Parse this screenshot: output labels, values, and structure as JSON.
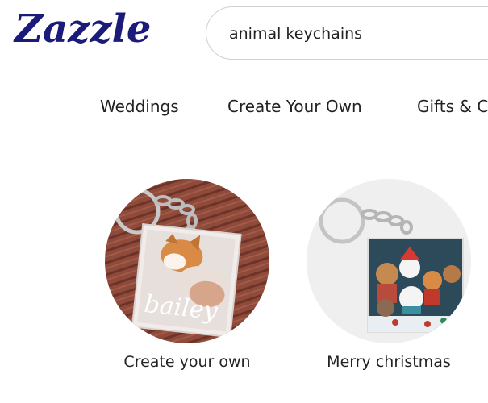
{
  "brand": {
    "name": "Zazzle"
  },
  "search": {
    "value": "animal keychains"
  },
  "nav": {
    "items": [
      "Weddings",
      "Create Your Own",
      "Gifts & C"
    ]
  },
  "cards": [
    {
      "label": "Create your own",
      "image_text": "bailey"
    },
    {
      "label": "Merry christmas"
    }
  ],
  "colors": {
    "brand": "#1b1b7a",
    "wood": "#8e4a3a",
    "card2_bg": "#efefef"
  }
}
